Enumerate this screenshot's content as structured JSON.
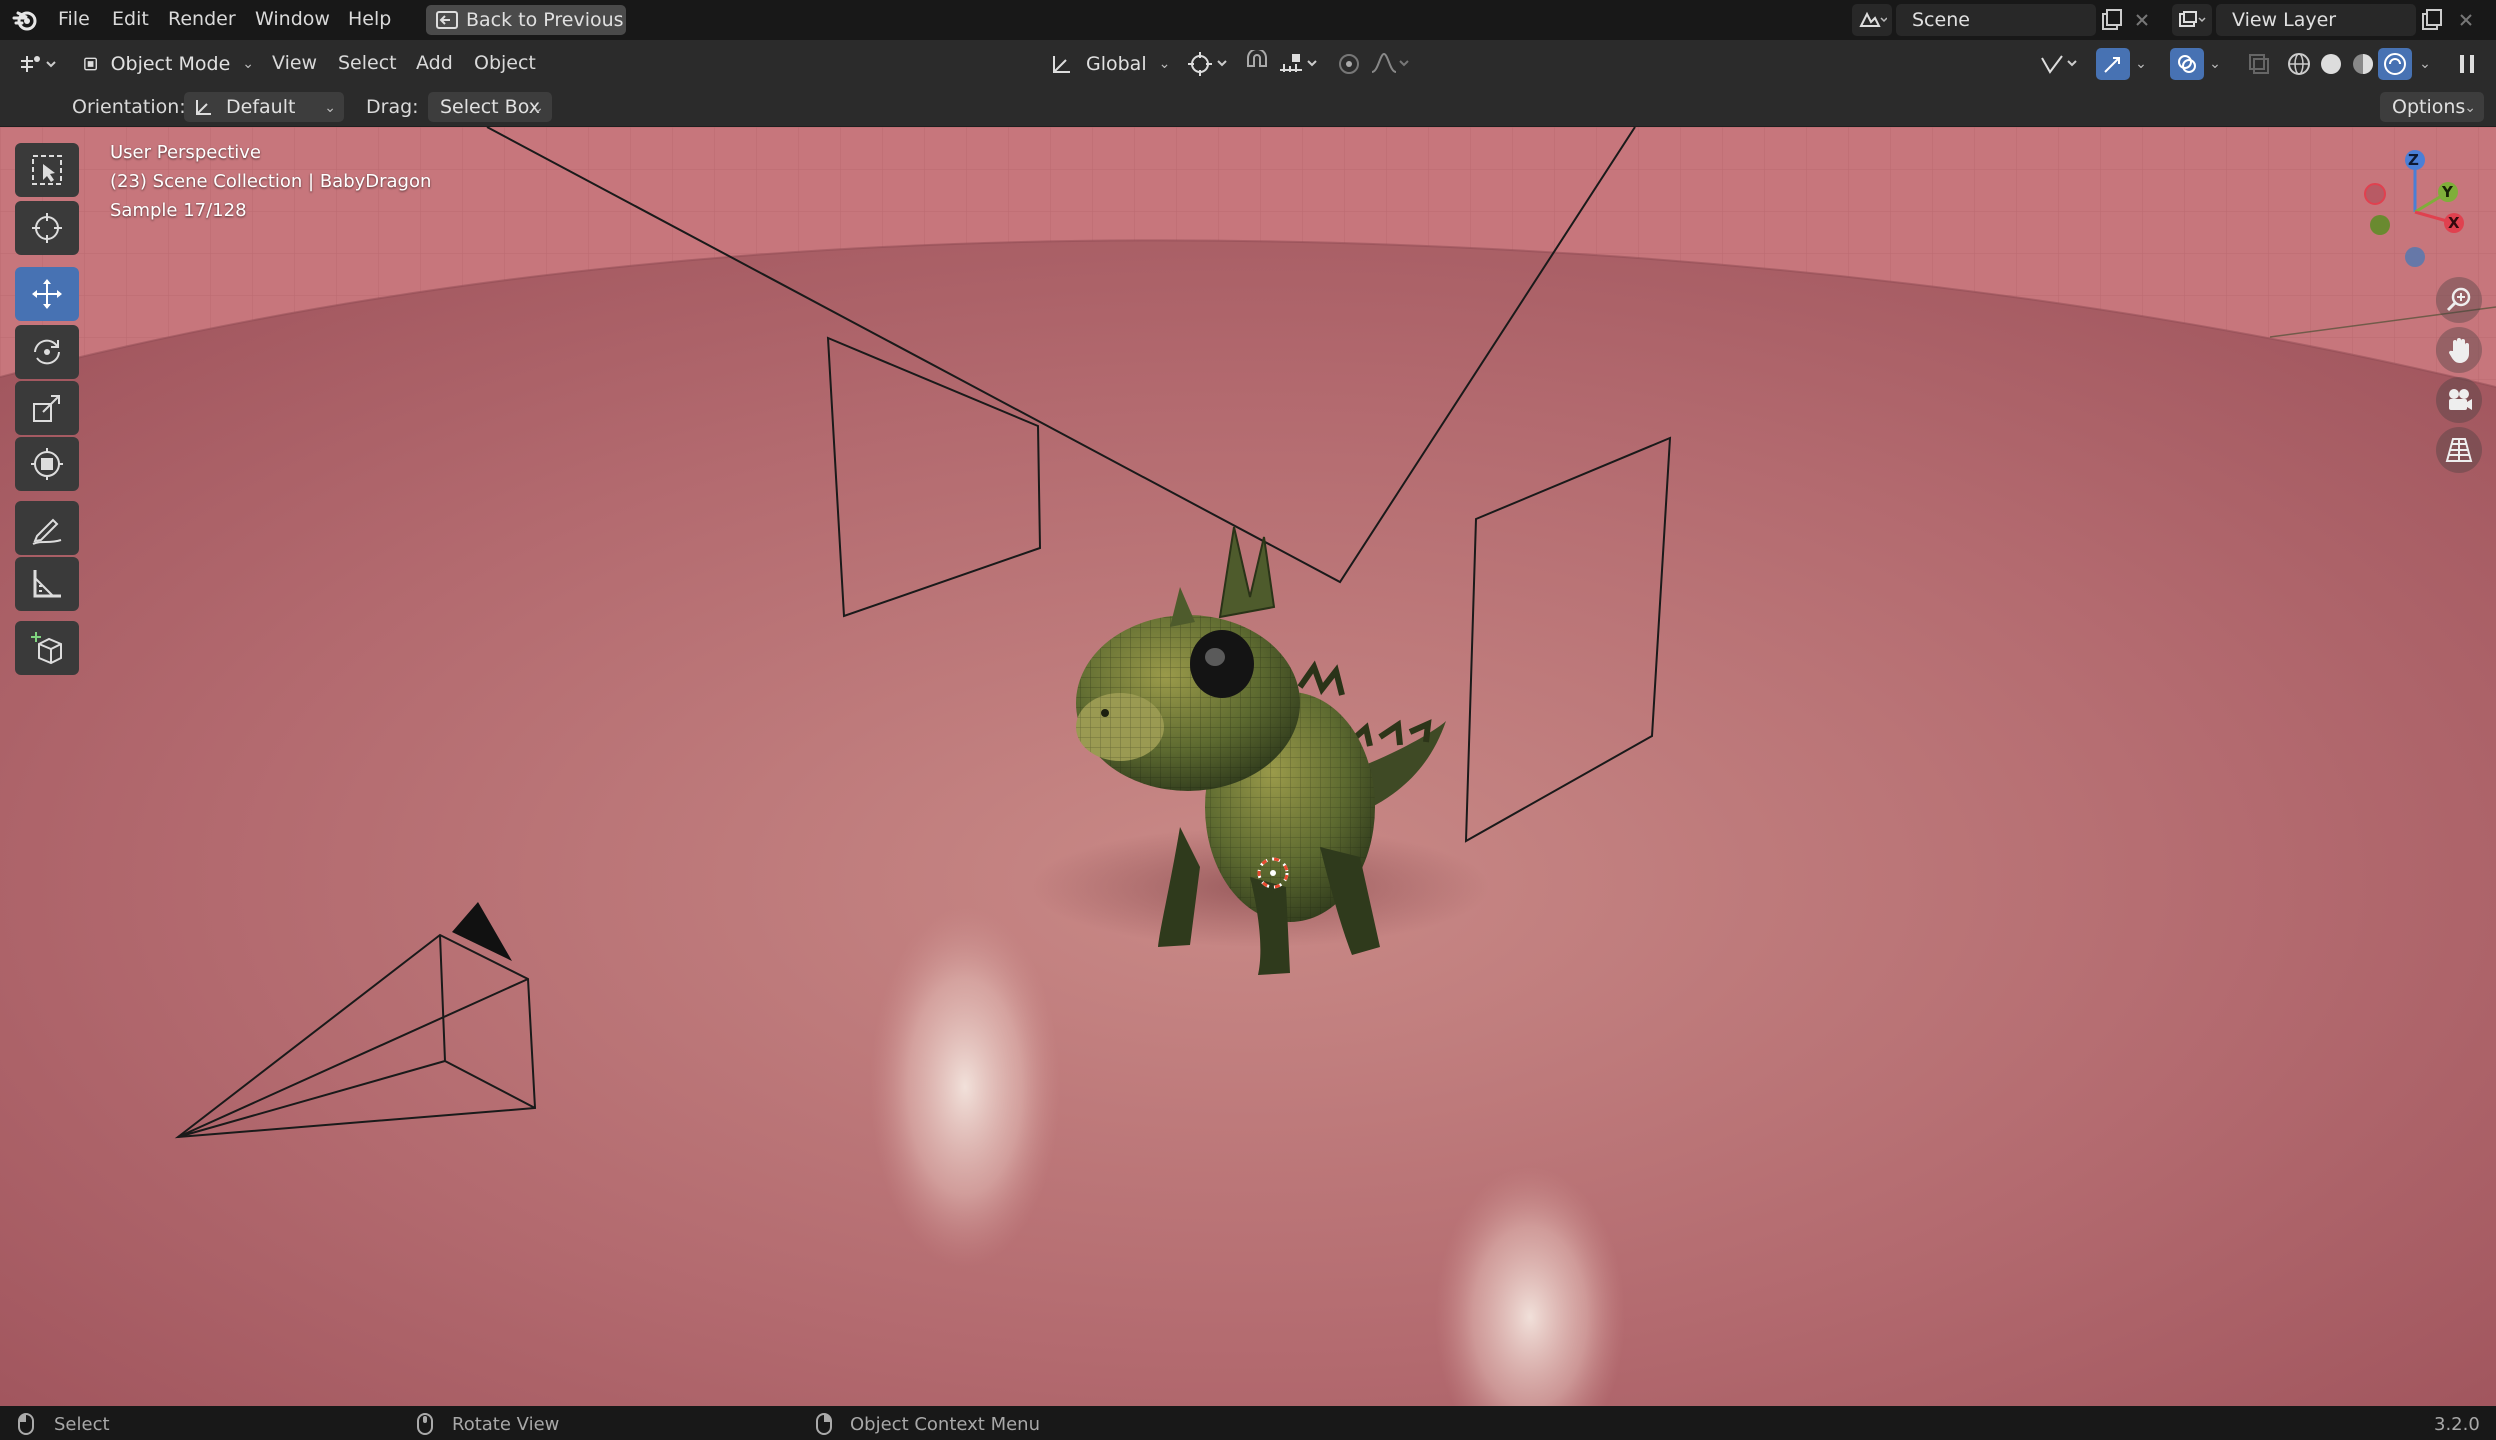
{
  "topbar": {
    "menu": [
      "File",
      "Edit",
      "Render",
      "Window",
      "Help"
    ],
    "back_button": "Back to Previous",
    "scene_label": "Scene",
    "view_layer_label": "View Layer"
  },
  "header": {
    "mode": "Object Mode",
    "menu": [
      "View",
      "Select",
      "Add",
      "Object"
    ],
    "transform_orientation": "Global"
  },
  "tool_settings": {
    "orientation_label": "Orientation:",
    "orientation_value": "Default",
    "drag_label": "Drag:",
    "drag_value": "Select Box",
    "options_label": "Options"
  },
  "viewport": {
    "view_name": "User Perspective",
    "collection_info": "(23) Scene Collection | BabyDragon",
    "sample_info": "Sample 17/128",
    "gizmo_axes": {
      "x": "X",
      "y": "Y",
      "z": "Z"
    }
  },
  "toolbar": {
    "tools": [
      "select-box-tool",
      "cursor-tool",
      "move-tool",
      "rotate-tool",
      "scale-tool",
      "transform-tool",
      "annotate-tool",
      "measure-tool",
      "add-cube-tool"
    ],
    "active": "move-tool"
  },
  "statusbar": {
    "left_action": "Select",
    "middle_action": "Rotate View",
    "right_action": "Object Context Menu",
    "version": "3.2.0"
  },
  "colors": {
    "accent": "#4772b3",
    "floor": "#b0656b",
    "backdrop": "#c7727a"
  }
}
